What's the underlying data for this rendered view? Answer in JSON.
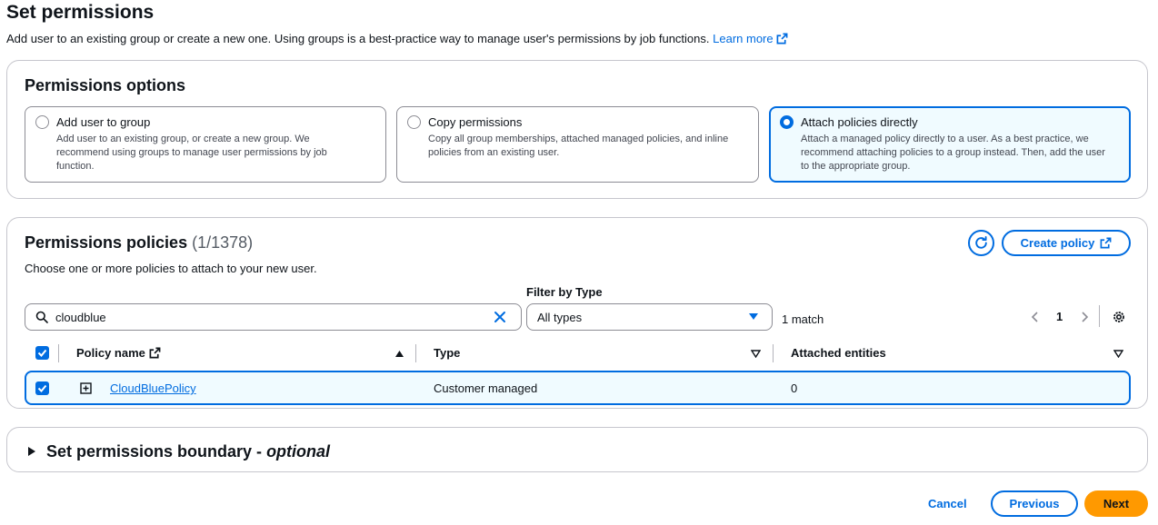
{
  "header": {
    "title": "Set permissions",
    "description": "Add user to an existing group or create a new one. Using groups is a best-practice way to manage user's permissions by job functions.",
    "learn_more": "Learn more"
  },
  "options": {
    "title": "Permissions options",
    "items": [
      {
        "label": "Add user to group",
        "desc": "Add user to an existing group, or create a new group. We recommend using groups to manage user permissions by job function.",
        "selected": false
      },
      {
        "label": "Copy permissions",
        "desc": "Copy all group memberships, attached managed policies, and inline policies from an existing user.",
        "selected": false
      },
      {
        "label": "Attach policies directly",
        "desc": "Attach a managed policy directly to a user. As a best practice, we recommend attaching policies to a group instead. Then, add the user to the appropriate group.",
        "selected": true
      }
    ]
  },
  "policies": {
    "title": "Permissions policies",
    "count": "(1/1378)",
    "subtitle": "Choose one or more policies to attach to your new user.",
    "create_policy": "Create policy",
    "search_value": "cloudblue",
    "filter_label": "Filter by Type",
    "filter_value": "All types",
    "match_text": "1 match",
    "page": "1",
    "columns": {
      "name": "Policy name",
      "type": "Type",
      "attached": "Attached entities"
    },
    "rows": [
      {
        "name": "CloudBluePolicy",
        "type": "Customer managed",
        "attached": "0",
        "checked": true
      }
    ]
  },
  "boundary": {
    "title": "Set permissions boundary - ",
    "optional": "optional"
  },
  "footer": {
    "cancel": "Cancel",
    "previous": "Previous",
    "next": "Next"
  },
  "colors": {
    "accent": "#006ce0",
    "primary_button": "#ff9900",
    "selected_tile_bg": "#f0fbff"
  }
}
